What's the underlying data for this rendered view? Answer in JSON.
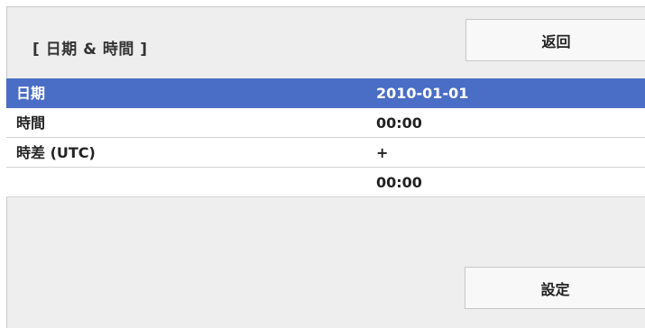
{
  "header": {
    "title": "[ 日期 & 時間 ]",
    "back_label": "返回"
  },
  "rows": [
    {
      "label": "日期",
      "value": "2010-01-01",
      "selected": true
    },
    {
      "label": "時間",
      "value": "00:00",
      "selected": false
    },
    {
      "label": "時差 (UTC)",
      "value": "+",
      "selected": false
    },
    {
      "label": "",
      "value": "00:00",
      "selected": false
    }
  ],
  "footer": {
    "set_label": "設定"
  },
  "colors": {
    "selection": "#4a6dc5",
    "panel_bg": "#eeeeee"
  }
}
